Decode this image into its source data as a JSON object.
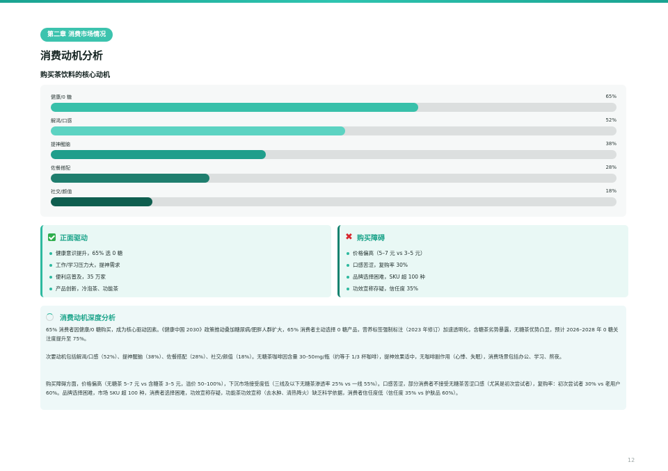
{
  "chapter": "第二章 消费市场情况",
  "title": "消费动机分析",
  "subtitle": "购买茶饮料的核心动机",
  "chart_data": {
    "type": "bar",
    "orientation": "horizontal",
    "categories": [
      "健康/0 糖",
      "解渴/口感",
      "提神醒脑",
      "佐餐搭配",
      "社交/颜值"
    ],
    "values": [
      65,
      52,
      38,
      28,
      18
    ],
    "value_labels": [
      "65%",
      "52%",
      "38%",
      "28%",
      "18%"
    ],
    "xlim": [
      0,
      100
    ],
    "colors": [
      "#38c0aa",
      "#5cd3c2",
      "#1f9e8b",
      "#1f7e6e",
      "#0f5e4f"
    ],
    "track_color": "#dcdfdf",
    "grid": false
  },
  "positive": {
    "title": "正面驱动",
    "icon": "check-box-icon",
    "items": [
      "健康意识提升，65% 选 0 糖",
      "工作/学习压力大，提神需求",
      "便利店普及，35 万家",
      "产品创新，冷泡茶、功能茶"
    ]
  },
  "barrier": {
    "title": "购买障碍",
    "icon": "cross-icon",
    "icon_glyph": "✖",
    "items": [
      "价格偏高（5–7 元 vs 3–5 元）",
      "口感苦涩，复购率 30%",
      "品牌选择困难，SKU 超 100 种",
      "功效宣称存疑，信任度 35%"
    ]
  },
  "analysis": {
    "title": "消费动机深度分析",
    "paragraphs": [
      "65% 消费者因健康/0 糖购买，成为核心驱动因素。《健康中国 2030》政策推动叠加糖尿病/肥胖人群扩大，65% 消费者主动选择 0 糖产品，营养标签强制标注（2023 年修订）加速透明化，含糖茶劣势暴露，无糖茶优势凸显，预计 2026–2028 年 0 糖关注度提升至 75%。",
      "次要动机包括解渴/口感（52%）、提神醒脑（38%）、佐餐搭配（28%）、社交/颜值（18%）。无糖茶咖啡因含量 30–50mg/瓶（约等于 1/3 杯咖啡），提神效果适中，无咖啡副作用（心悸、失眠），消费场景包括办公、学习、熬夜。",
      "购买障碍方面，价格偏高（无糖茶 5–7 元 vs 含糖茶 3–5 元，溢价 50–100%），下沉市场接受度低（三线及以下无糖茶渗透率 25% vs 一线 55%）。口感苦涩，部分消费者不接受无糖茶苦涩口感（尤其是初次尝试者），复购率：初次尝试者 30% vs 老用户 60%。品牌选择困难，市场 SKU 超 100 种，消费者选择困难，功效宣称存疑，功能茶功效宣称（去水肿、清热降火）缺乏科学依据，消费者信任度低（信任度 35% vs 护肤品 60%）。"
    ]
  },
  "page_number": "12"
}
